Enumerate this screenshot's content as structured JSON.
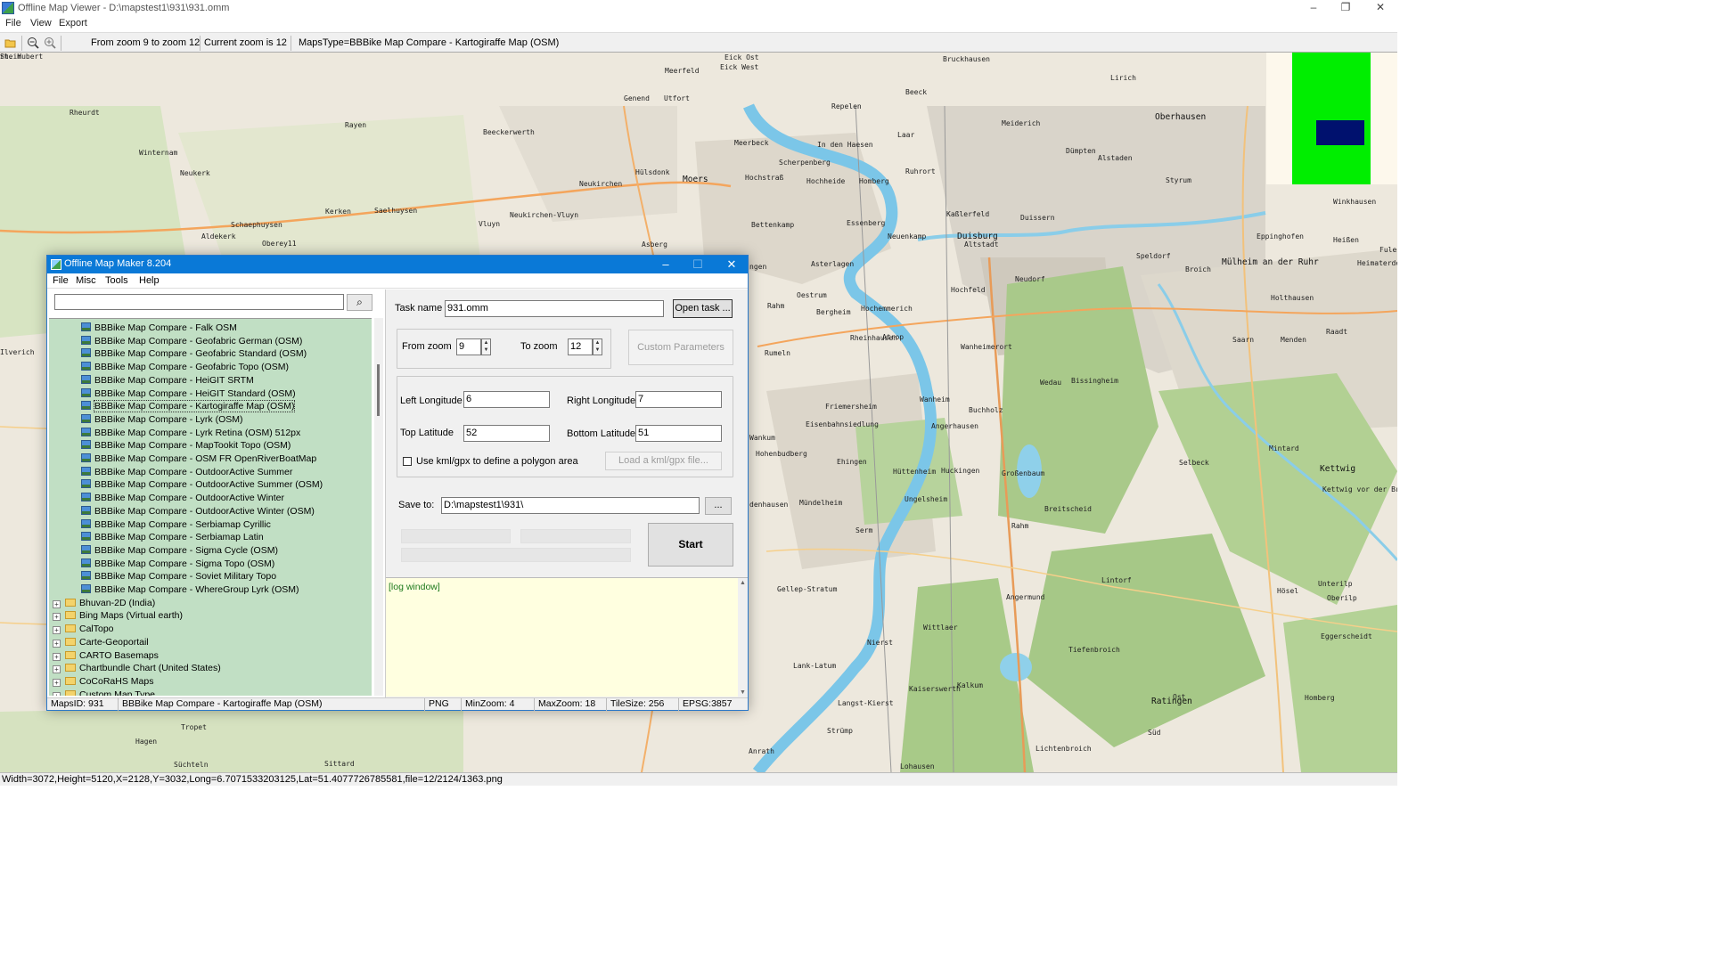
{
  "window": {
    "title": "Offline Map Viewer - D:\\mapstest1\\931\\931.omm"
  },
  "menubar": {
    "file": "File",
    "view": "View",
    "export": "Export"
  },
  "toolbar": {
    "zoom_range": "From zoom 9 to zoom 12",
    "current_zoom": "Current zoom is 12",
    "maps_type": "MapsType=BBBike Map Compare - Kartogiraffe Map (OSM)"
  },
  "statusbar": {
    "text": "Width=3072,Height=5120,X=2128,Y=3032,Long=6.7071533203125,Lat=51.4077726785581,file=12/2124/1363.png"
  },
  "map_labels": [
    "Bruckhausen",
    "Beeck",
    "Lirich",
    "Oberhausen",
    "Meiderich",
    "Laar",
    "Dümpten",
    "Alstaden",
    "Ruhrort",
    "Styrum",
    "Kaßlerfeld",
    "Duissern",
    "Duisburg",
    "Altstadt",
    "Speldorf",
    "Broich",
    "Mülheim an der Ruhr",
    "Eppinghofen",
    "Heißen",
    "Winkhausen",
    "Holthausen",
    "Menden",
    "Saarn",
    "Raadt",
    "Heimaterde",
    "Fulerum",
    "Selbeck",
    "Kettwig",
    "Kettwig vor der Brücke",
    "Mintard",
    "Bissingheim",
    "Wedau",
    "Buchholz",
    "Hochfeld",
    "Neudorf",
    "Wanheimerort",
    "Wanheim",
    "Angerhausen",
    "Hüttenheim",
    "Huckingen",
    "Großenbaum",
    "Rahm",
    "Ungelsheim",
    "Serm",
    "Breitscheid",
    "Lintorf",
    "Hösel",
    "Unterilp",
    "Oberilp",
    "Eggerscheidt",
    "Homberg",
    "Ratingen",
    "Ost",
    "Süd",
    "Lichtenbroich",
    "Tiefenbroich",
    "Angermund",
    "Wittlaer",
    "Kalkum",
    "Kaiserswerth",
    "Lohausen",
    "Nierst",
    "Lank-Latum",
    "Langst-Kierst",
    "Gellep-Stratum",
    "Mündelheim",
    "Ehingen",
    "Hohenbudberg",
    "Eisenbahnsiedlung",
    "Friemersheim",
    "Rheinhausen",
    "Atrop",
    "Hochemmerich",
    "Bergheim",
    "Oestrum",
    "Asterlagen",
    "Rumeln",
    "Essenberg",
    "Neuenkamp",
    "Homberg",
    "Hochheide",
    "Hochstraß",
    "Moers",
    "Scherpenberg",
    "In den Haesen",
    "Meerbeck",
    "Hülsdonk",
    "Neukirchen",
    "Neukirchen-Vluyn",
    "Vluyn",
    "Bettenkamp",
    "Asberg",
    "Genend",
    "Utfort",
    "Meerfeld",
    "Eick West",
    "Eick Ost",
    "Repelen",
    "Beeckerwerth",
    "Rayen",
    "Rheurdt",
    "Winternam",
    "Neukerk",
    "Kerken",
    "Saelhuysen",
    "Schaephuysen",
    "Aldekerk",
    "Oberey11",
    "Rahm",
    "Tropet",
    "Hagen",
    "Süchteln",
    "Sittard",
    "Anrath",
    "Strümp",
    "Ilverich",
    "Wankum",
    "denhausen",
    "ngen",
    "rheim",
    "St. Hubert"
  ],
  "dialog": {
    "title": "Offline Map Maker 8.204",
    "menu": {
      "file": "File",
      "misc": "Misc",
      "tools": "Tools",
      "help": "Help"
    },
    "search": {
      "value": "",
      "icon": "search-icon"
    },
    "tree_leaves": [
      "BBBike Map Compare - Falk OSM",
      "BBBike Map Compare - Geofabric German (OSM)",
      "BBBike Map Compare - Geofabric Standard (OSM)",
      "BBBike Map Compare - Geofabric Topo (OSM)",
      "BBBike Map Compare - HeiGIT SRTM",
      "BBBike Map Compare - HeiGIT Standard (OSM)",
      "BBBike Map Compare - Kartogiraffe Map (OSM)",
      "BBBike Map Compare - Lyrk (OSM)",
      "BBBike Map Compare - Lyrk Retina (OSM) 512px",
      "BBBike Map Compare - MapTookit Topo (OSM)",
      "BBBike Map Compare - OSM FR OpenRiverBoatMap",
      "BBBike Map Compare - OutdoorActive Summer",
      "BBBike Map Compare - OutdoorActive Summer (OSM)",
      "BBBike Map Compare - OutdoorActive Winter",
      "BBBike Map Compare - OutdoorActive Winter (OSM)",
      "BBBike Map Compare - Serbiamap Cyrillic",
      "BBBike Map Compare - Serbiamap Latin",
      "BBBike Map Compare - Sigma Cycle (OSM)",
      "BBBike Map Compare - Sigma Topo (OSM)",
      "BBBike Map Compare - Soviet Military Topo",
      "BBBike Map Compare - WhereGroup Lyrk (OSM)"
    ],
    "tree_folders": [
      "Bhuvan-2D (India)",
      "Bing Maps (Virtual earth)",
      "CalTopo",
      "Carte-Geoportail",
      "CARTO Basemaps",
      "Chartbundle Chart (United States)",
      "CoCoRaHS Maps",
      "Custom Map Type"
    ],
    "form": {
      "task_name_label": "Task name",
      "task_name": "931.omm",
      "open_task": "Open task ...",
      "from_zoom_label": "From zoom",
      "from_zoom": "9",
      "to_zoom_label": "To zoom",
      "to_zoom": "12",
      "custom_params": "Custom Parameters",
      "left_lon_label": "Left Longitude",
      "left_lon": "6",
      "right_lon_label": "Right Longitude",
      "right_lon": "7",
      "top_lat_label": "Top Latitude",
      "top_lat": "52",
      "bottom_lat_label": "Bottom Latitude",
      "bottom_lat": "51",
      "kml_label": "Use kml/gpx to define a polygon area",
      "load_kml": "Load a kml/gpx file...",
      "save_to_label": "Save to:",
      "save_to": "D:\\mapstest1\\931\\",
      "browse": "...",
      "start": "Start",
      "log": "[log window]"
    },
    "status": {
      "maps_id": "MapsID: 931",
      "maps_name": "BBBike Map Compare - Kartogiraffe Map (OSM)",
      "format": "PNG",
      "min_zoom": "MinZoom: 4",
      "max_zoom": "MaxZoom: 18",
      "tile_size": "TileSize: 256",
      "epsg": "EPSG:3857"
    }
  },
  "colors": {
    "accent": "#0a79d7",
    "tree_bg": "#c1dfc4",
    "log_bg": "#ffffe0",
    "overview_green": "#00ee00",
    "overview_blue": "#00116e",
    "river": "#7bc6e8",
    "forest": "#a8c986",
    "urban": "#d8d2c4"
  }
}
